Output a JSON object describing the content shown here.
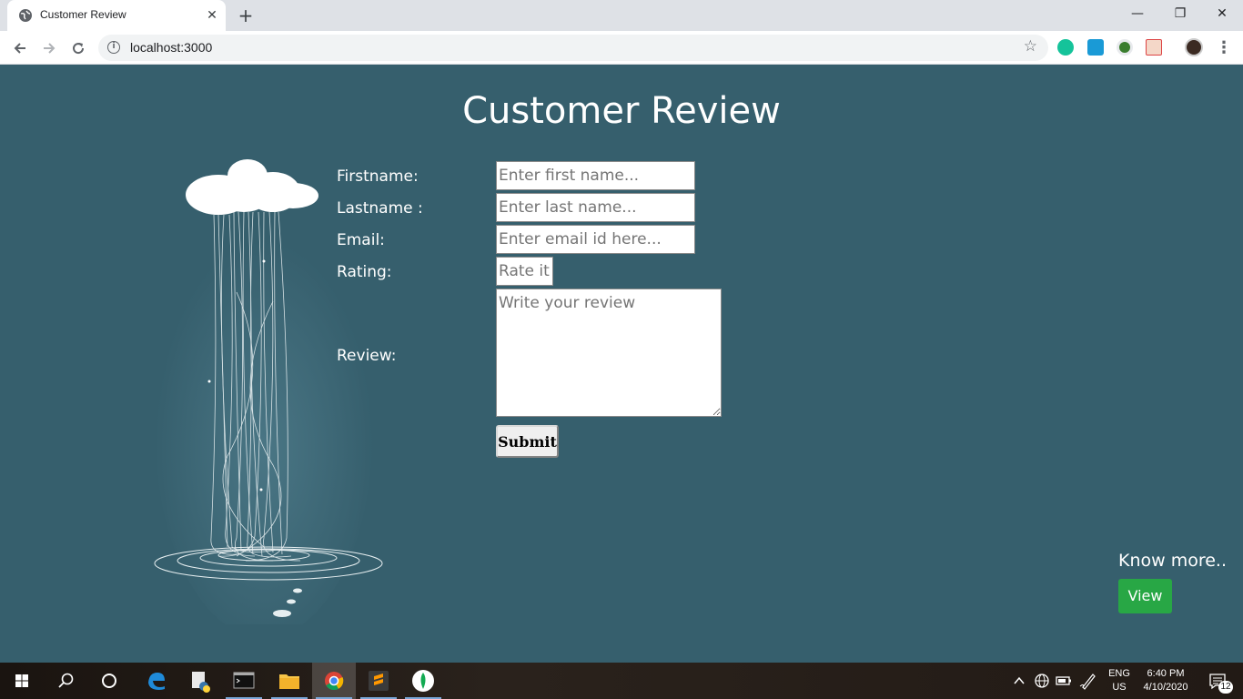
{
  "browser": {
    "tab_title": "Customer Review",
    "tab_close": "✕",
    "new_tab": "+",
    "url": "localhost:3000",
    "window_controls": {
      "minimize": "—",
      "restore": "❐",
      "close": "✕"
    }
  },
  "page": {
    "title": "Customer Review",
    "form": {
      "firstname_label": "Firstname:",
      "firstname_placeholder": "Enter first name...",
      "lastname_label": "Lastname :",
      "lastname_placeholder": "Enter last name...",
      "email_label": "Email:",
      "email_placeholder": "Enter email id here...",
      "rating_label": "Rating:",
      "rating_placeholder": "Rate it",
      "review_label": "Review:",
      "review_placeholder": "Write your review",
      "submit_label": "Submit"
    },
    "know_more": "Know more..",
    "view_label": "View"
  },
  "taskbar": {
    "language_line1": "ENG",
    "language_line2": "US",
    "time": "6:40 PM",
    "date": "4/10/2020",
    "notification_count": "12"
  },
  "colors": {
    "page_background": "#365f6d",
    "view_button": "#28a745"
  }
}
